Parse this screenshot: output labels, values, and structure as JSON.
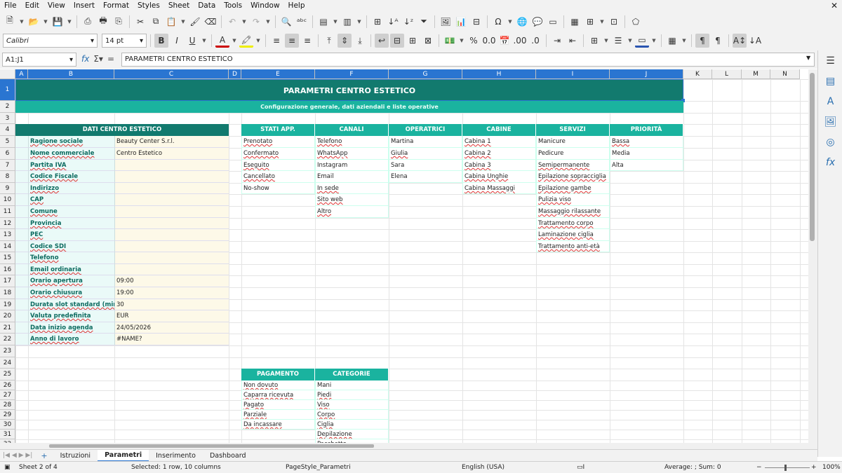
{
  "menu": [
    "File",
    "Edit",
    "View",
    "Insert",
    "Format",
    "Styles",
    "Sheet",
    "Data",
    "Tools",
    "Window",
    "Help"
  ],
  "font": {
    "name": "Calibri",
    "size": "14 pt"
  },
  "namebox": "A1:J1",
  "formula": "PARAMETRI CENTRO ESTETICO",
  "columns": [
    "A",
    "B",
    "C",
    "D",
    "E",
    "F",
    "G",
    "H",
    "I",
    "J",
    "K",
    "L",
    "M",
    "N"
  ],
  "rows": [
    "1",
    "2",
    "3",
    "4",
    "5",
    "6",
    "7",
    "8",
    "9",
    "10",
    "11",
    "12",
    "13",
    "14",
    "15",
    "16",
    "17",
    "18",
    "19",
    "20",
    "21",
    "22",
    "23",
    "24",
    "25",
    "26",
    "27",
    "28",
    "29",
    "30",
    "31",
    "32"
  ],
  "title": "PARAMETRI CENTRO ESTETICO",
  "subtitle": "Configurazione generale, dati aziendali e liste operative",
  "dati": {
    "header": "DATI CENTRO ESTETICO",
    "rows": [
      {
        "label": "Ragione sociale",
        "value": "Beauty Center S.r.l."
      },
      {
        "label": "Nome commerciale",
        "value": "Centro Estetico"
      },
      {
        "label": "Partita IVA",
        "value": ""
      },
      {
        "label": "Codice Fiscale",
        "value": ""
      },
      {
        "label": "Indirizzo",
        "value": ""
      },
      {
        "label": "CAP",
        "value": ""
      },
      {
        "label": "Comune",
        "value": ""
      },
      {
        "label": "Provincia",
        "value": ""
      },
      {
        "label": "PEC",
        "value": ""
      },
      {
        "label": "Codice SDI",
        "value": ""
      },
      {
        "label": "Telefono",
        "value": ""
      },
      {
        "label": "Email ordinaria",
        "value": ""
      },
      {
        "label": "Orario apertura",
        "value": "09:00"
      },
      {
        "label": "Orario chiusura",
        "value": "19:00"
      },
      {
        "label": "Durata slot standard (min)",
        "value": "30"
      },
      {
        "label": "Valuta predefinita",
        "value": "EUR"
      },
      {
        "label": "Data inizio agenda",
        "value": "24/05/2026"
      },
      {
        "label": "Anno di lavoro",
        "value": "#NAME?"
      }
    ]
  },
  "lists": [
    {
      "header": "STATI APP.",
      "items": [
        "Prenotato",
        "Confermato",
        "Eseguito",
        "Cancellato",
        "No-show"
      ]
    },
    {
      "header": "CANALI",
      "items": [
        "Telefono",
        "WhatsApp",
        "Instagram",
        "Email",
        "In sede",
        "Sito web",
        "Altro"
      ]
    },
    {
      "header": "OPERATRICI",
      "items": [
        "Martina",
        "Giulia",
        "Sara",
        "Elena"
      ]
    },
    {
      "header": "CABINE",
      "items": [
        "Cabina 1",
        "Cabina 2",
        "Cabina 3",
        "Cabina Unghie",
        "Cabina Massaggi"
      ]
    },
    {
      "header": "SERVIZI",
      "items": [
        "Manicure",
        "Pedicure",
        "Semipermanente",
        "Epilazione sopracciglia",
        "Epilazione gambe",
        "Pulizia viso",
        "Massaggio rilassante",
        "Trattamento corpo",
        "Laminazione ciglia",
        "Trattamento anti-età"
      ]
    },
    {
      "header": "PRIORITÀ",
      "items": [
        "Bassa",
        "Media",
        "Alta"
      ]
    }
  ],
  "lists2": [
    {
      "header": "PAGAMENTO",
      "items": [
        "Non dovuto",
        "Caparra ricevuta",
        "Pagato",
        "Parziale",
        "Da incassare"
      ]
    },
    {
      "header": "CATEGORIE",
      "items": [
        "Mani",
        "Piedi",
        "Viso",
        "Corpo",
        "Ciglia",
        "Depilazione",
        "Pacchetto"
      ]
    }
  ],
  "tabs": [
    "Istruzioni",
    "Parametri",
    "Inserimento",
    "Dashboard"
  ],
  "status": {
    "sheet": "Sheet 2 of 4",
    "selection": "Selected: 1 row, 10 columns",
    "pagestyle": "PageStyle_Parametri",
    "lang": "English (USA)",
    "calc": "Average: ; Sum: 0",
    "zoom": "100%"
  },
  "colors": {
    "teal_dark": "#127a6e",
    "teal": "#1ab39f",
    "label_bg": "#eafaf8",
    "value_bg": "#fdf9e8",
    "selection": "#2a75d1"
  }
}
